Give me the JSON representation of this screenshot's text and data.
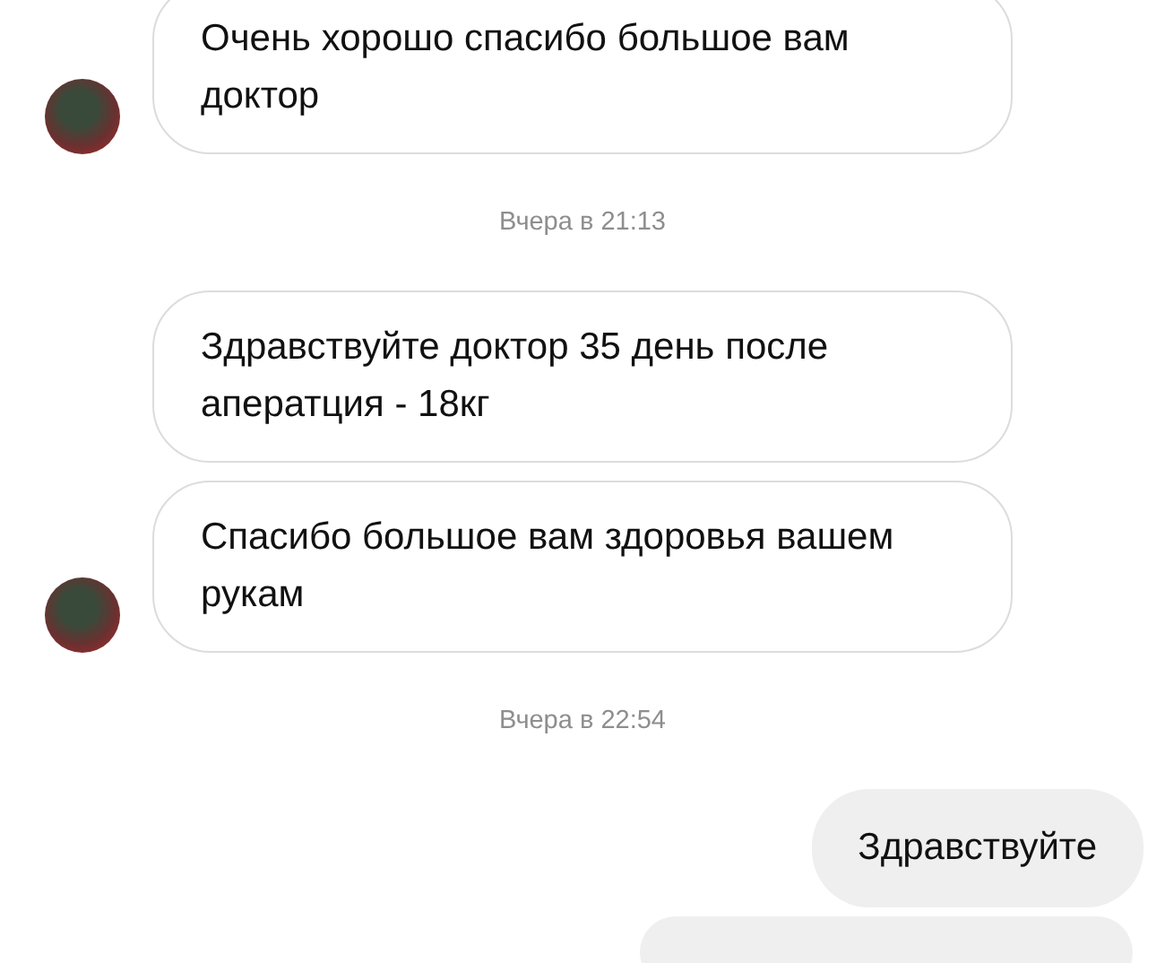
{
  "messages": [
    {
      "kind": "incoming",
      "bubbles": [
        "Очень хорошо спасибо большое вам доктор"
      ]
    },
    {
      "kind": "timestamp",
      "text": "Вчера в 21:13"
    },
    {
      "kind": "incoming",
      "bubbles": [
        "Здравствуйте доктор 35 день после аператция - 18кг",
        "Спасибо большое вам здоровья вашем рукам"
      ]
    },
    {
      "kind": "timestamp",
      "text": "Вчера в 22:54"
    },
    {
      "kind": "outgoing",
      "text": "Здравствуйте"
    },
    {
      "kind": "outgoing_partial"
    }
  ]
}
